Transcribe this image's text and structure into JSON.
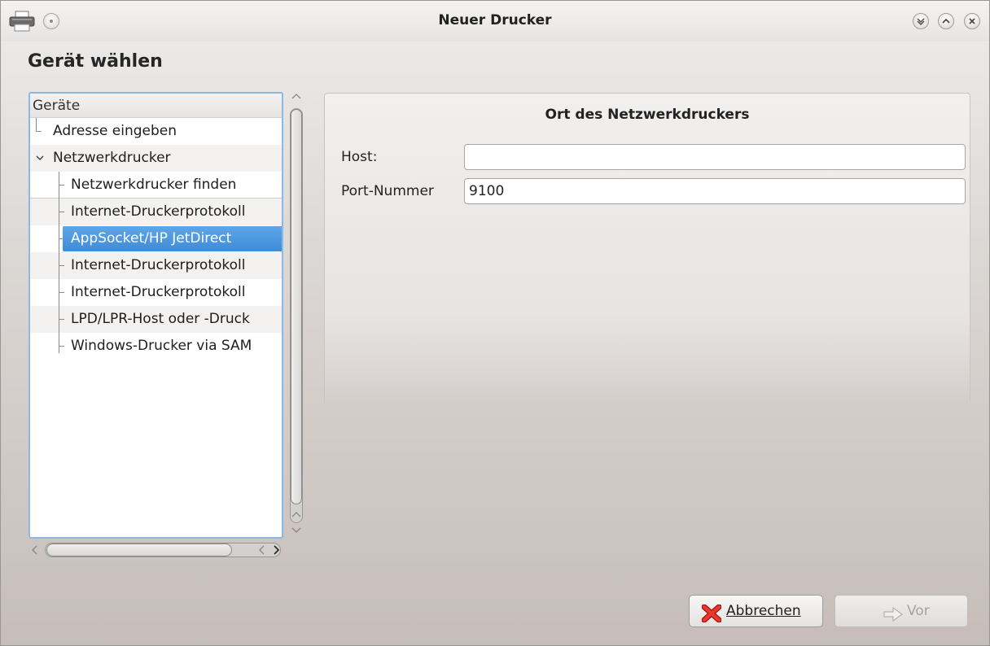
{
  "window": {
    "title": "Neuer Drucker"
  },
  "page": {
    "heading": "Gerät wählen"
  },
  "tree": {
    "header": "Geräte",
    "items": [
      {
        "label": "Adresse eingeben",
        "level": 1,
        "selected": false
      },
      {
        "label": "Netzwerkdrucker",
        "level": 1,
        "expanded": true,
        "selected": false
      },
      {
        "label": "Netzwerkdrucker finden",
        "level": 2,
        "selected": false
      },
      {
        "label": "Internet-Druckerprotokoll",
        "level": 2,
        "selected": false
      },
      {
        "label": "AppSocket/HP JetDirect",
        "level": 2,
        "selected": true
      },
      {
        "label": "Internet-Druckerprotokoll",
        "level": 2,
        "selected": false
      },
      {
        "label": "Internet-Druckerprotokoll",
        "level": 2,
        "selected": false
      },
      {
        "label": "LPD/LPR-Host oder -Druck",
        "level": 2,
        "selected": false
      },
      {
        "label": "Windows-Drucker via SAM",
        "level": 2,
        "selected": false
      }
    ]
  },
  "details": {
    "group_title": "Ort des Netzwerkdruckers",
    "host_label": "Host:",
    "host_value": "",
    "port_label": "Port-Nummer",
    "port_value": "9100"
  },
  "buttons": {
    "cancel_label": "Abbrechen",
    "next_label": "Vor",
    "next_enabled": false
  },
  "colors": {
    "selection": "#3e8bd8",
    "focus_border": "#8fb7e0",
    "cancel_icon": "#d9261c"
  },
  "icons": {
    "app": "printer-icon",
    "menu": "window-menu-icon",
    "minimize": "minimize-icon",
    "maximize": "maximize-icon",
    "close": "close-icon",
    "cancel": "cancel-x-icon",
    "next": "arrow-right-icon"
  }
}
